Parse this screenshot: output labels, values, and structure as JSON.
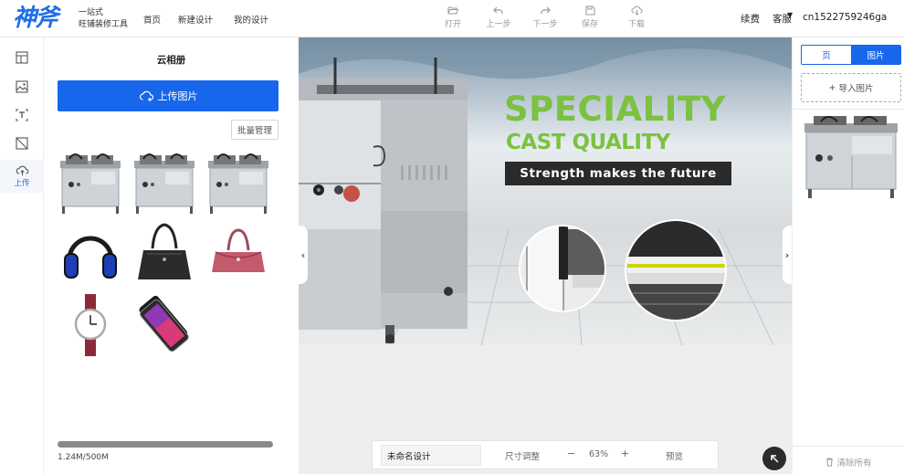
{
  "header": {
    "logo": "神斧",
    "tagline_line1": "一站式",
    "tagline_line2": "旺铺装修工具",
    "nav": [
      "首页",
      "新建设计",
      "我的设计"
    ],
    "tools": {
      "open": "打开",
      "undo": "上一步",
      "redo": "下一步",
      "save": "保存",
      "download": "下载"
    },
    "renew": "续费",
    "service": "客服",
    "username": "cn1522759246ga"
  },
  "rail": {
    "upload_label": "上传"
  },
  "left_panel": {
    "title": "云相册",
    "upload_button": "上传图片",
    "batch_button": "批量管理",
    "storage_used_fraction": 0.0025,
    "storage_text": "1.24M/500M"
  },
  "banner": {
    "headline1": "SPECIALITY",
    "headline2": "CAST QUALITY",
    "slogan": "Strength makes the future"
  },
  "bottom_bar": {
    "design_name": "未命名设计",
    "resize": "尺寸调整",
    "minus": "−",
    "zoom": "63%",
    "plus": "+",
    "preview": "预览"
  },
  "right_panel": {
    "tab_page": "页",
    "tab_image": "图片",
    "import_button": "导入图片",
    "clear_all": "清除所有"
  },
  "colors": {
    "accent": "#1766ec",
    "banner_green": "#7cc141"
  }
}
